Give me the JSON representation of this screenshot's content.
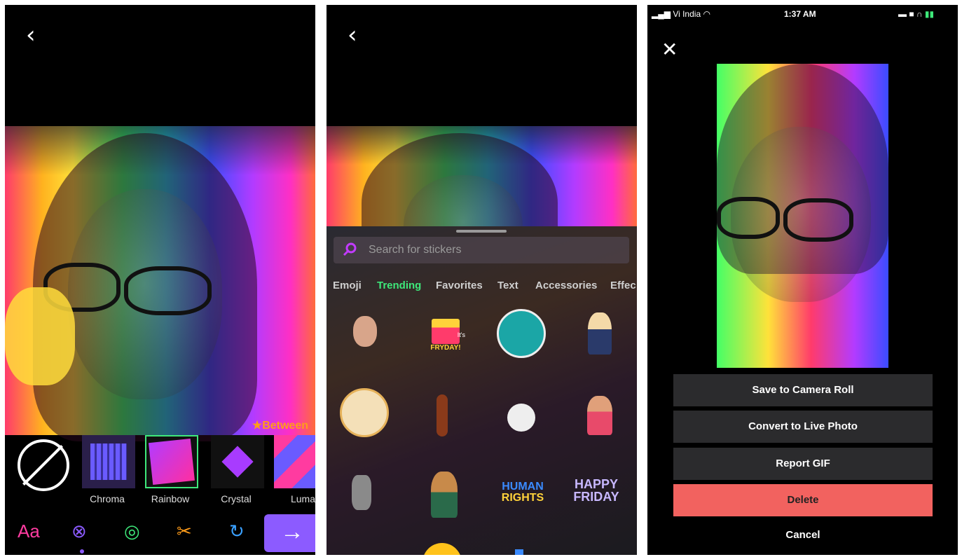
{
  "panel1": {
    "back_icon": "chevron-left-icon",
    "watermark": "Between",
    "filters": [
      {
        "label": ""
      },
      {
        "label": "Chroma"
      },
      {
        "label": "Rainbow"
      },
      {
        "label": "Crystal"
      },
      {
        "label": "Luma"
      }
    ],
    "tools": {
      "text_label": "Aa",
      "next_icon": "arrow-right-icon"
    }
  },
  "panel2": {
    "back_icon": "chevron-left-icon",
    "search_placeholder": "Search for stickers",
    "categories": [
      "Emoji",
      "Trending",
      "Favorites",
      "Text",
      "Accessories",
      "Effec"
    ],
    "active_category": "Trending",
    "sticker_texts": {
      "fryday_small": "It's",
      "fryday": "FRYDAY!",
      "human_rights_1": "HUMAN",
      "human_rights_2": "RIGHTS",
      "happy_friday_1": "HAPPY",
      "happy_friday_2": "FRIDAY"
    }
  },
  "panel3": {
    "status": {
      "carrier": "Vi India",
      "time": "1:37 AM"
    },
    "close_icon": "close-icon",
    "actions": {
      "save": "Save to Camera Roll",
      "convert": "Convert to Live Photo",
      "report": "Report GIF",
      "delete": "Delete",
      "cancel": "Cancel"
    },
    "colors": {
      "delete": "#f2625f",
      "accent": "#8c5bff",
      "active_tab": "#3ee87a"
    }
  }
}
